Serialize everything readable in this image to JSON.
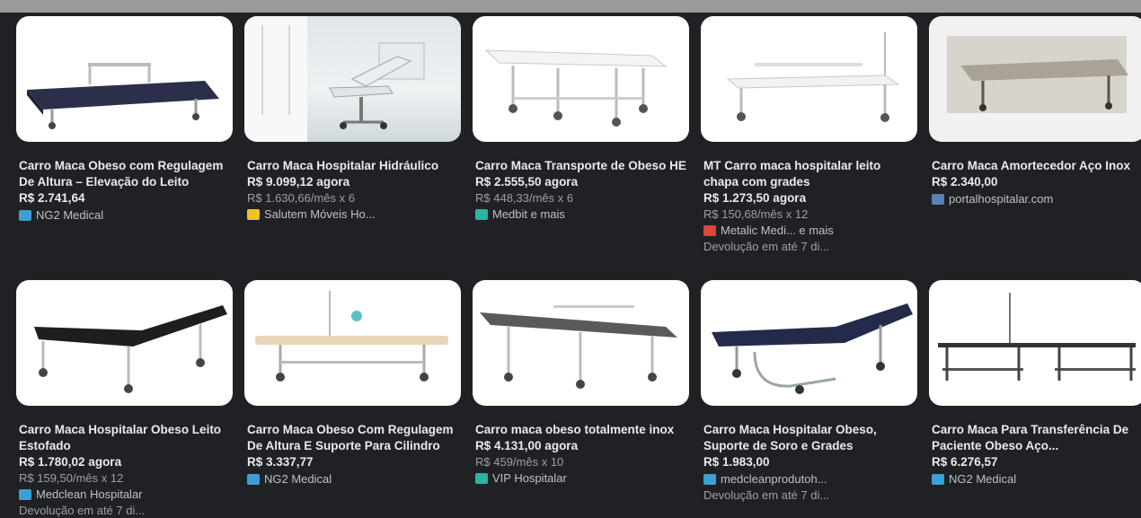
{
  "products": [
    {
      "title": "Carro Maca Obeso com Regulagem De Altura – Elevação do Leito",
      "price": "R$ 2.741,64",
      "installment": "",
      "seller": "NG2 Medical",
      "seller_color": "#3aa0d8",
      "returns": "",
      "image_icon": "stretcher-image"
    },
    {
      "title": "Carro Maca Hospitalar Hidráulico",
      "price": "R$ 9.099,12 agora",
      "installment": "R$ 1.630,66/mês x 6",
      "seller": "Salutem Móveis Ho...",
      "seller_color": "#f0c419",
      "returns": "",
      "image_icon": "stretcher-image"
    },
    {
      "title": "Carro Maca Transporte de Obeso HE",
      "price": "R$ 2.555,50 agora",
      "installment": "R$ 448,33/mês x 6",
      "seller": "Medbit e mais",
      "seller_color": "#2ab5a0",
      "returns": "",
      "image_icon": "stretcher-image"
    },
    {
      "title": "MT Carro maca hospitalar leito chapa com grades",
      "price": "R$ 1.273,50 agora",
      "installment": "R$ 150,68/mês x 12",
      "seller": "Metalic Medi... e mais",
      "seller_color": "#d9473a",
      "returns": "Devolução em até 7 di...",
      "image_icon": "stretcher-image"
    },
    {
      "title": "Carro Maca Amortecedor Aço Inox",
      "price": "R$ 2.340,00",
      "installment": "",
      "seller": "portalhospitalar.com",
      "seller_color": "#5a7fb8",
      "returns": "",
      "image_icon": "stretcher-image"
    },
    {
      "title": "Carro Maca Hospitalar Obeso Leito Estofado",
      "price": "R$ 1.780,02 agora",
      "installment": "R$ 159,50/mês x 12",
      "seller": "Medclean Hospitalar",
      "seller_color": "#3aa0d8",
      "returns": "Devolução em até 7 di...",
      "image_icon": "stretcher-image"
    },
    {
      "title": "Carro Maca Obeso Com Regulagem De Altura E Suporte Para Cilindro",
      "price": "R$ 3.337,77",
      "installment": "",
      "seller": "NG2 Medical",
      "seller_color": "#3aa0d8",
      "returns": "",
      "image_icon": "stretcher-image"
    },
    {
      "title": "Carro maca obeso totalmente inox",
      "price": "R$ 4.131,00 agora",
      "installment": "R$ 459/mês x 10",
      "seller": "VIP Hospitalar",
      "seller_color": "#2ab5a0",
      "returns": "",
      "image_icon": "stretcher-image"
    },
    {
      "title": "Carro Maca Hospitalar Obeso, Suporte de Soro e Grades",
      "price": "R$ 1.983,00",
      "installment": "",
      "seller": "medcleanprodutoh...",
      "seller_color": "#3aa0d8",
      "returns": "Devolução em até 7 di...",
      "image_icon": "stretcher-image"
    },
    {
      "title": "Carro Maca Para Transferência De Paciente Obeso Aço...",
      "price": "R$ 6.276,57",
      "installment": "",
      "seller": "NG2 Medical",
      "seller_color": "#3aa0d8",
      "returns": "",
      "image_icon": "stretcher-image"
    }
  ]
}
